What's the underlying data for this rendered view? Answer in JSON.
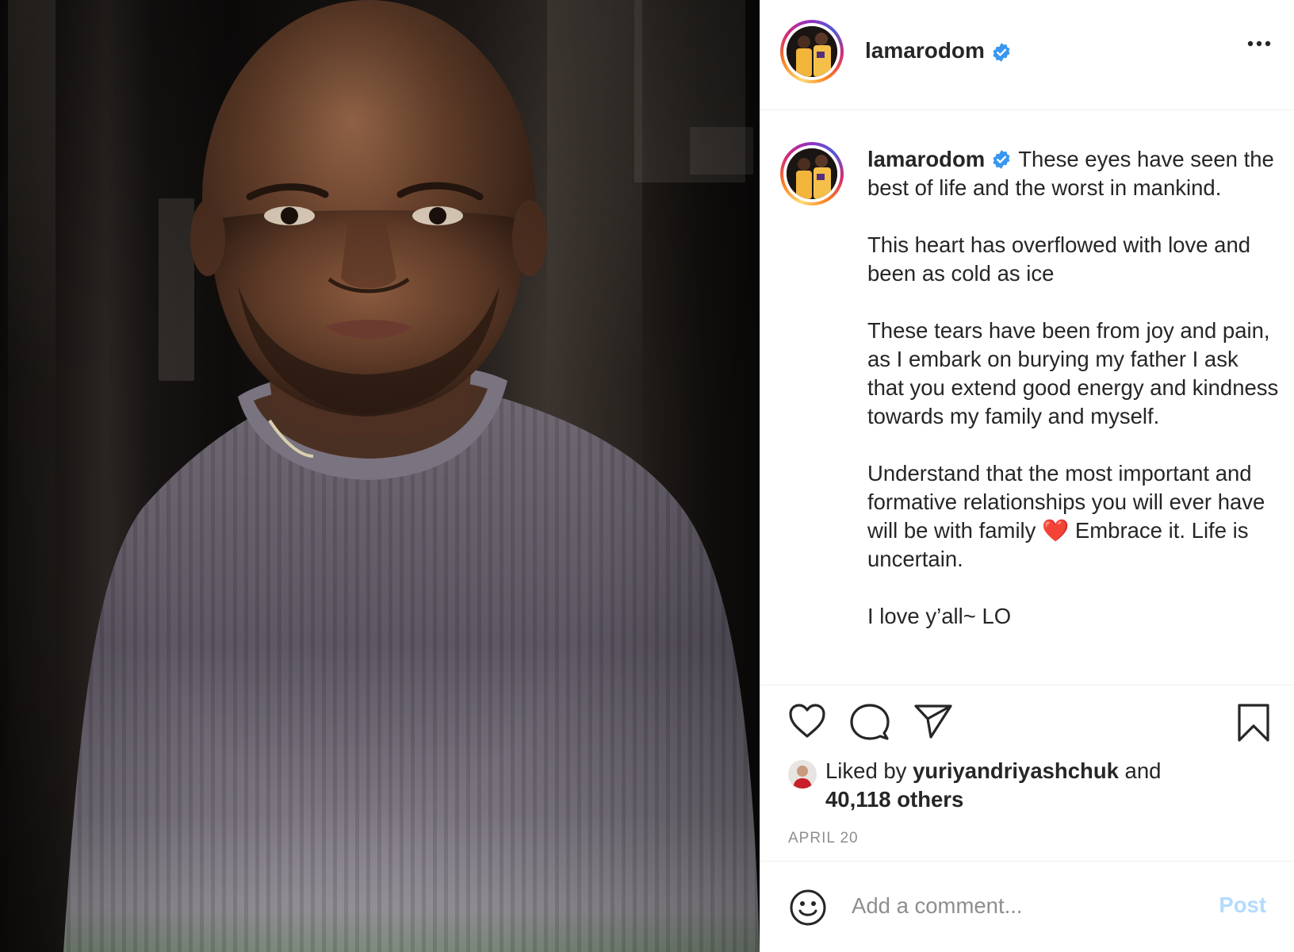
{
  "post": {
    "author": "lamarodom",
    "verified": true,
    "more_icon": "more-horizontal-icon",
    "caption_username": "lamarodom",
    "caption_text": "These eyes have seen the best of life and the worst in mankind.\n\nThis heart has overflowed with love and been as cold as ice\n\nThese tears have been from joy and pain, as I embark on burying my father I ask that you extend good energy and kindness towards my family and myself.\n\nUnderstand that the most important and formative relationships you will ever have will be with family ❤️ Embrace it. Life is uncertain.\n\nI love y’all~ LO",
    "likes": {
      "prefix": "Liked by",
      "user": "yuriyandriyashchuk",
      "conjunction": "and",
      "others": "40,118 others"
    },
    "date": "APRIL 20"
  },
  "actions": {
    "like_icon": "heart-icon",
    "comment_icon": "comment-icon",
    "share_icon": "paper-plane-icon",
    "save_icon": "bookmark-icon"
  },
  "comment": {
    "placeholder": "Add a comment...",
    "post_label": "Post",
    "emoji_icon": "smiley-icon"
  },
  "colors": {
    "verified_blue": "#3897f0",
    "post_disabled": "#b3dbff",
    "muted": "#8e8e8e",
    "text": "#262626"
  }
}
